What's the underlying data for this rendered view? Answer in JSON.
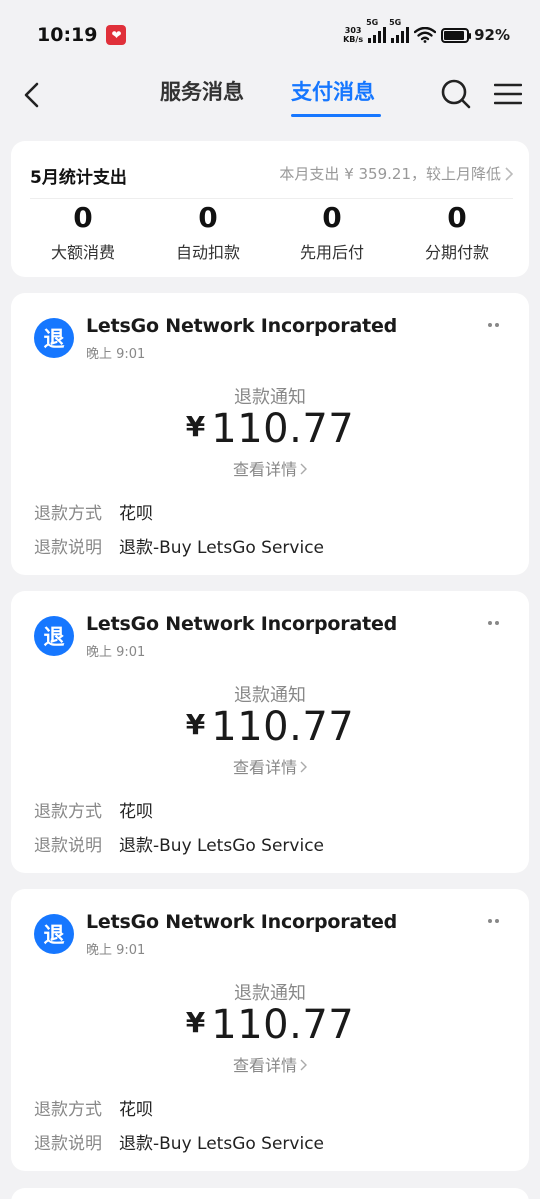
{
  "status_bar": {
    "time": "10:19",
    "net_speed_value": "303",
    "net_speed_unit": "KB/s",
    "sim1_label": "5G",
    "sim2_label": "5G",
    "battery": "92%",
    "battery_level": 0.92
  },
  "nav": {
    "tabs": [
      {
        "label": "服务消息",
        "active": false
      },
      {
        "label": "支付消息",
        "active": true
      }
    ],
    "accent": "#1677ff"
  },
  "stats": {
    "title": "5月统计支出",
    "summary": "本月支出 ¥ 359.21，较上月降低",
    "items": [
      {
        "value": "0",
        "label": "大额消费"
      },
      {
        "value": "0",
        "label": "自动扣款"
      },
      {
        "value": "0",
        "label": "先用后付"
      },
      {
        "value": "0",
        "label": "分期付款"
      }
    ]
  },
  "messages": [
    {
      "icon_text": "退",
      "merchant": "LetsGo Network Incorporated",
      "time": "晚上 9:01",
      "notice": "退款通知",
      "currency": "¥",
      "amount": "110.77",
      "detail_label": "查看详情",
      "method_key": "退款方式",
      "method_val": "花呗",
      "desc_key": "退款说明",
      "desc_val": "退款-Buy LetsGo Service"
    },
    {
      "icon_text": "退",
      "merchant": "LetsGo Network Incorporated",
      "time": "晚上 9:01",
      "notice": "退款通知",
      "currency": "¥",
      "amount": "110.77",
      "detail_label": "查看详情",
      "method_key": "退款方式",
      "method_val": "花呗",
      "desc_key": "退款说明",
      "desc_val": "退款-Buy LetsGo Service"
    },
    {
      "icon_text": "退",
      "merchant": "LetsGo Network Incorporated",
      "time": "晚上 9:01",
      "notice": "退款通知",
      "currency": "¥",
      "amount": "110.77",
      "detail_label": "查看详情",
      "method_key": "退款方式",
      "method_val": "花呗",
      "desc_key": "退款说明",
      "desc_val": "退款-Buy LetsGo Service"
    }
  ]
}
